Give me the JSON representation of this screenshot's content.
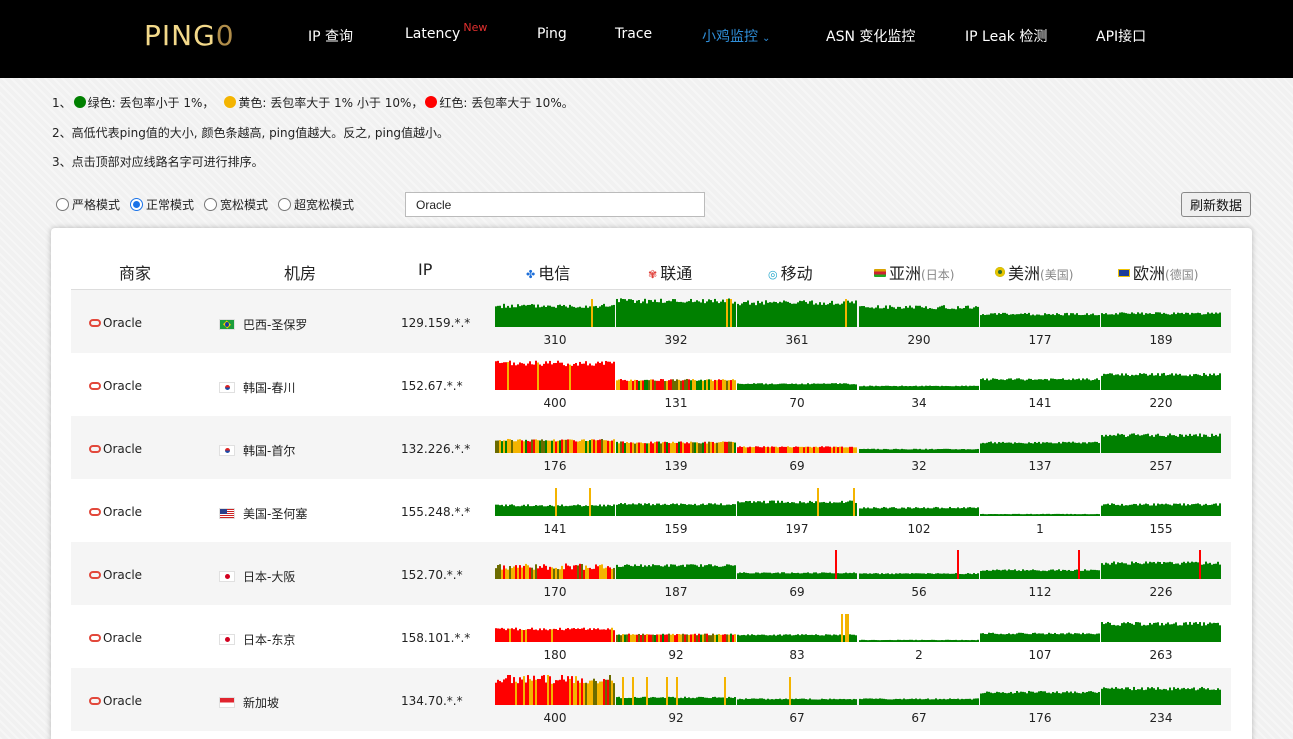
{
  "nav": {
    "logo_text": "PING",
    "logo_zero": "0",
    "items": [
      {
        "label": "IP 查询"
      },
      {
        "label": "Latency",
        "badge": "New"
      },
      {
        "label": "Ping"
      },
      {
        "label": "Trace"
      },
      {
        "label": "小鸡监控",
        "caret": "⌄",
        "active": true
      },
      {
        "label": "ASN 变化监控"
      },
      {
        "label": "IP Leak 检测"
      },
      {
        "label": "API接口"
      }
    ]
  },
  "notes": {
    "line1": {
      "prefix": "1、",
      "green": "绿色: 丢包率小于 1%，",
      "yellow": "黄色: 丢包率大于 1% 小于 10%，",
      "red": "红色: 丢包率大于 10%。"
    },
    "line2": "2、高低代表ping值的大小, 颜色条越高, ping值越大。反之, ping值越小。",
    "line3": "3、点击顶部对应线路名字可进行排序。"
  },
  "modes": [
    {
      "label": "严格模式",
      "checked": false
    },
    {
      "label": "正常模式",
      "checked": true
    },
    {
      "label": "宽松模式",
      "checked": false
    },
    {
      "label": "超宽松模式",
      "checked": false
    }
  ],
  "search": {
    "value": "Oracle"
  },
  "refresh_label": "刷新数据",
  "colors": {
    "green": "#008000",
    "yellow": "#f4b400",
    "red": "#ff0000",
    "dark": "#6b6b00"
  },
  "table": {
    "headers": {
      "vendor": "商家",
      "dc": "机房",
      "ip": "IP",
      "telecom": "电信",
      "unicom": "联通",
      "mobile": "移动",
      "asia": "亚洲",
      "asia_sub": "(日本)",
      "america": "美洲",
      "america_sub": "(美国)",
      "europe": "欧洲",
      "europe_sub": "(德国)"
    },
    "rows": [
      {
        "vendor": "Oracle",
        "flag": "br",
        "dc": "巴西-圣保罗",
        "ip": "129.159.*.*",
        "values": [
          310,
          392,
          361,
          290,
          177,
          189
        ],
        "patterns": [
          "green-sparse-yellow",
          "green-sparse-yellow",
          "green-sparse-yellow",
          "green",
          "green",
          "green"
        ]
      },
      {
        "vendor": "Oracle",
        "flag": "kr",
        "dc": "韩国-春川",
        "ip": "152.67.*.*",
        "values": [
          400,
          131,
          70,
          34,
          141,
          220
        ],
        "patterns": [
          "red",
          "mixed",
          "green",
          "green",
          "green",
          "green"
        ]
      },
      {
        "vendor": "Oracle",
        "flag": "kr",
        "dc": "韩国-首尔",
        "ip": "132.226.*.*",
        "values": [
          176,
          139,
          69,
          32,
          137,
          257
        ],
        "patterns": [
          "mixed",
          "mixed",
          "red-yellow",
          "green",
          "green",
          "green"
        ]
      },
      {
        "vendor": "Oracle",
        "flag": "us",
        "dc": "美国-圣何塞",
        "ip": "155.248.*.*",
        "values": [
          141,
          159,
          197,
          102,
          1,
          155
        ],
        "patterns": [
          "green-sparse-yellow",
          "green",
          "green-sparse-yellow",
          "green",
          "green",
          "green"
        ]
      },
      {
        "vendor": "Oracle",
        "flag": "jp",
        "dc": "日本-大阪",
        "ip": "152.70.*.*",
        "values": [
          170,
          187,
          69,
          56,
          112,
          226
        ],
        "patterns": [
          "mixed-red",
          "green",
          "green-spike",
          "green-spike",
          "green-spike",
          "green-spike"
        ]
      },
      {
        "vendor": "Oracle",
        "flag": "jp",
        "dc": "日本-东京",
        "ip": "158.101.*.*",
        "values": [
          180,
          92,
          83,
          2,
          107,
          263
        ],
        "patterns": [
          "red",
          "mixed",
          "green-sparse-yellow",
          "green",
          "green",
          "green"
        ]
      },
      {
        "vendor": "Oracle",
        "flag": "sg",
        "dc": "新加坡",
        "ip": "134.70.*.*",
        "values": [
          400,
          92,
          67,
          67,
          176,
          234
        ],
        "patterns": [
          "red-mixed",
          "green-sparse-yellow",
          "green-sparse-yellow",
          "green",
          "green",
          "green"
        ]
      }
    ]
  }
}
